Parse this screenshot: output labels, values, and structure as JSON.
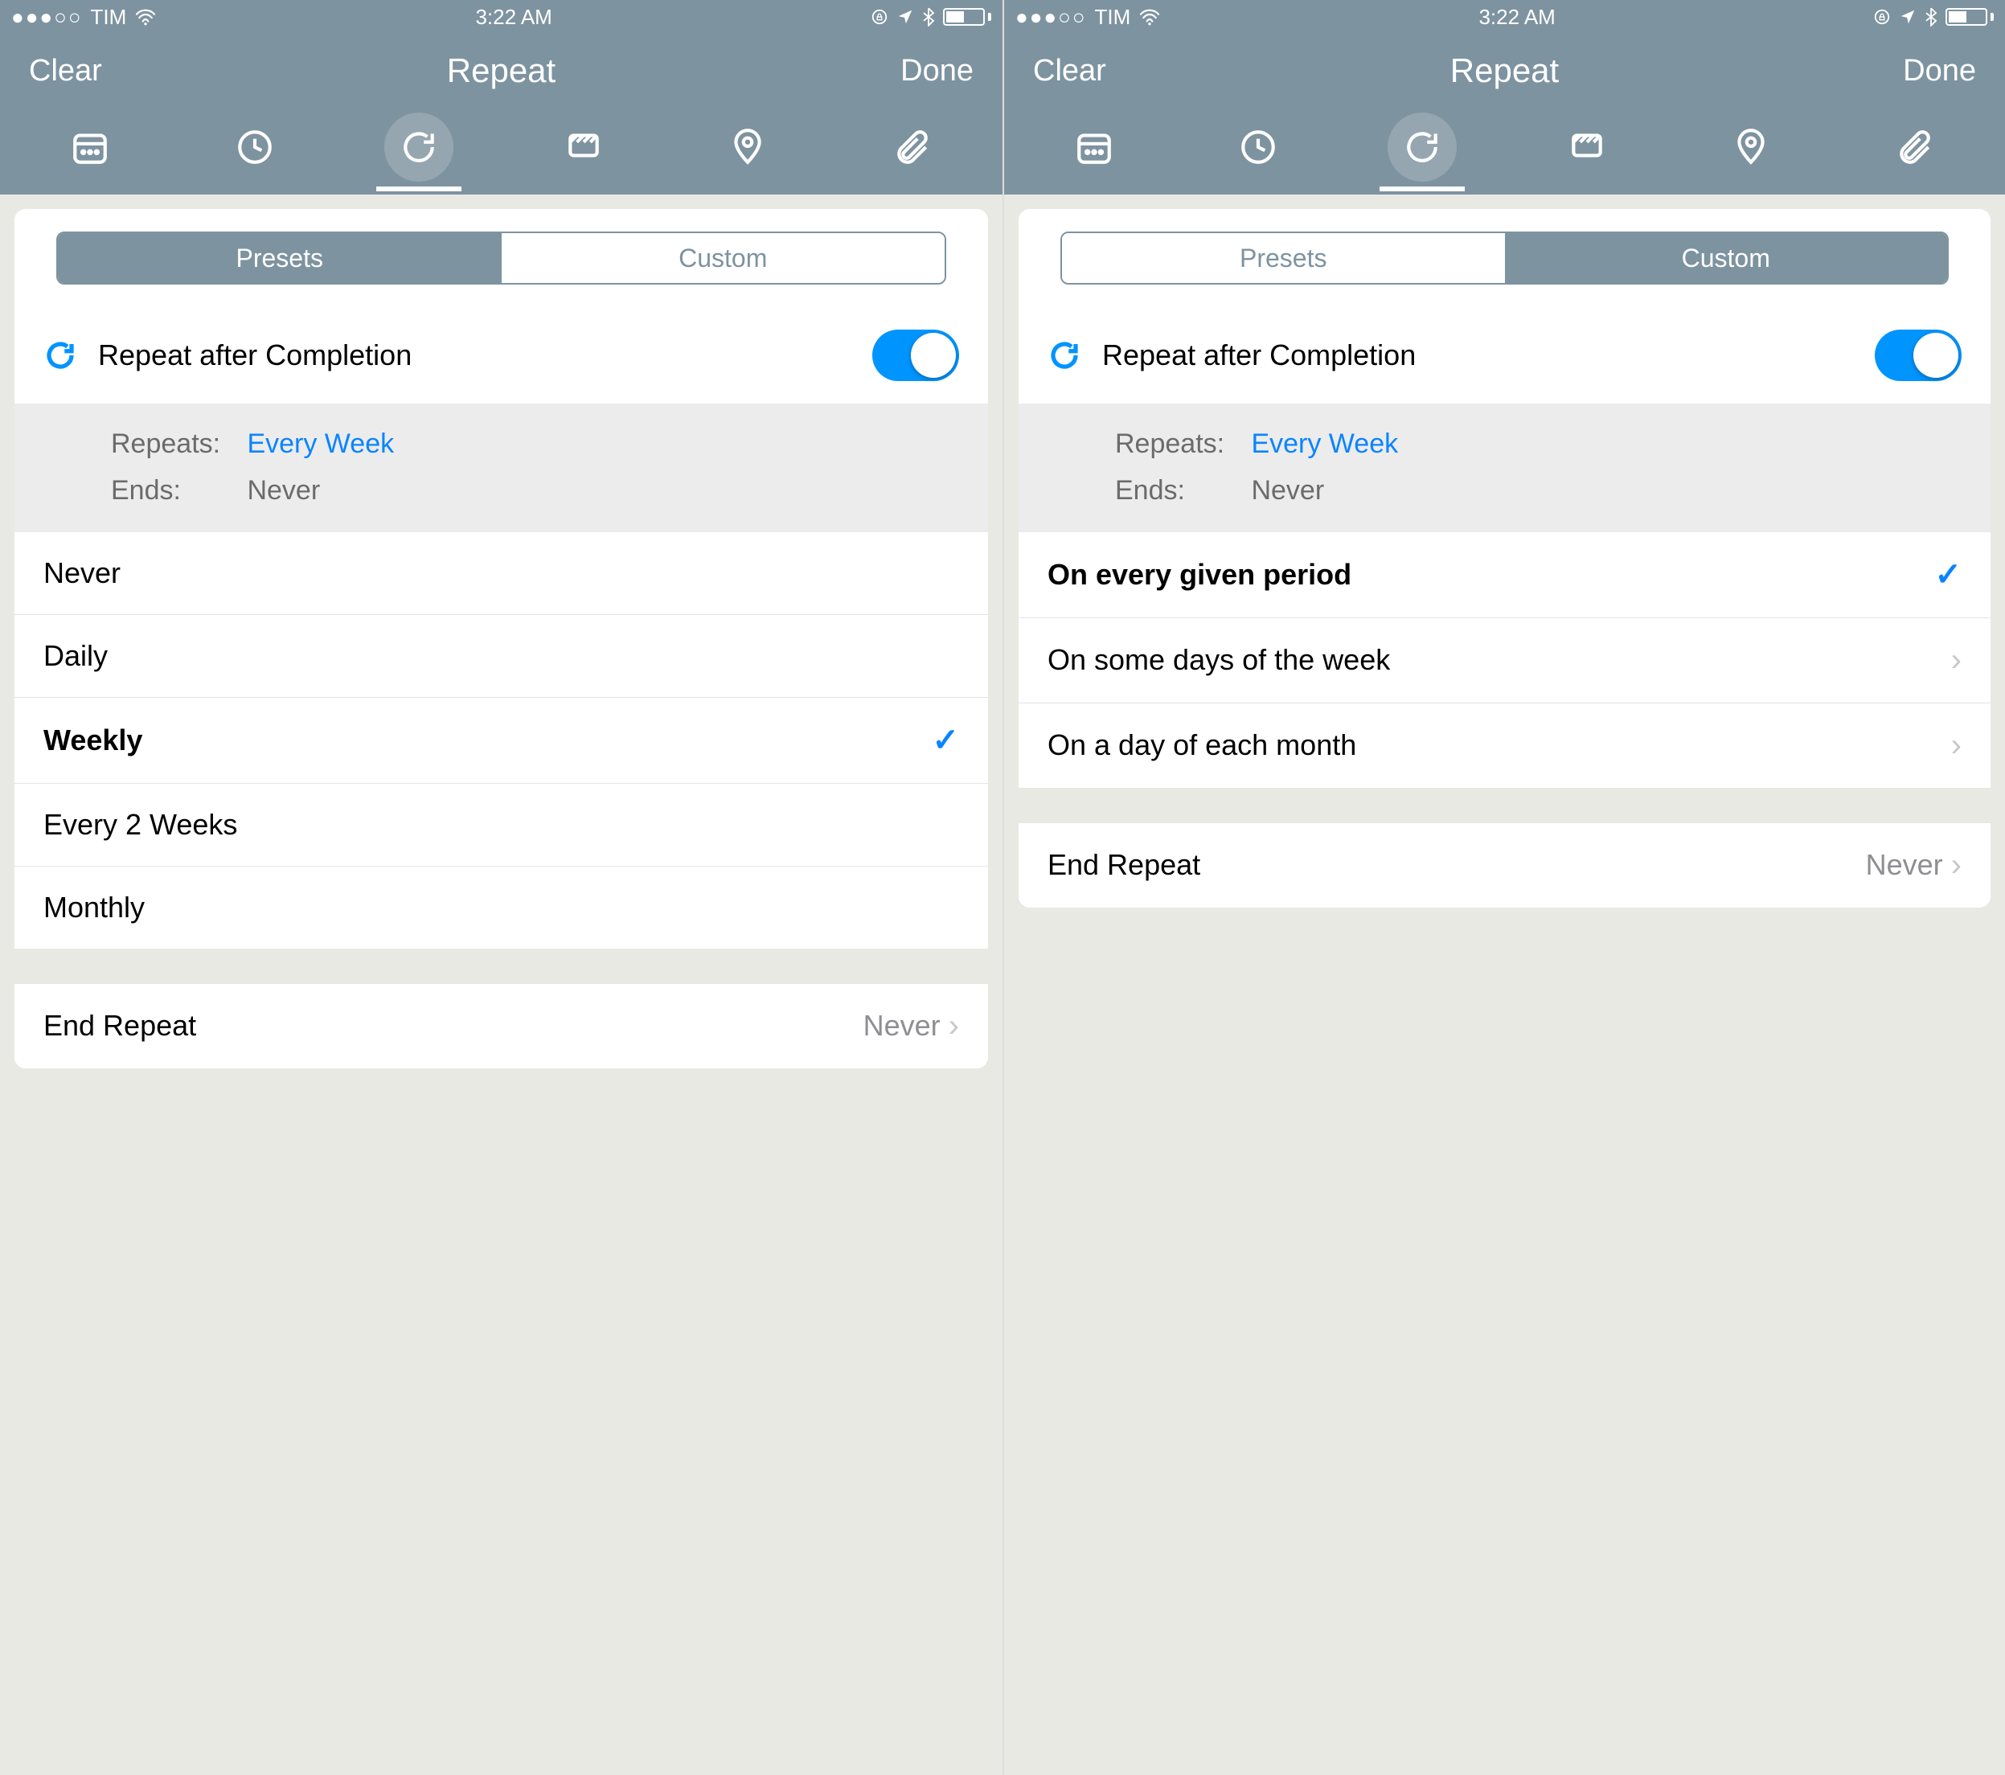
{
  "status": {
    "dots_filled": 3,
    "dots_total": 5,
    "carrier": "TIM",
    "time": "3:22 AM",
    "lock": true,
    "location": true,
    "bluetooth": true,
    "battery_pct": 45
  },
  "nav": {
    "left": "Clear",
    "title": "Repeat",
    "right": "Done"
  },
  "tabs": {
    "icons": [
      "calendar",
      "clock",
      "repeat",
      "flag",
      "location",
      "attachment"
    ],
    "active_index": 2
  },
  "segment": {
    "options": [
      "Presets",
      "Custom"
    ]
  },
  "repeat_row": {
    "label": "Repeat after Completion",
    "on": true
  },
  "summary": {
    "repeats_label": "Repeats:",
    "repeats_value": "Every Week",
    "ends_label": "Ends:",
    "ends_value": "Never"
  },
  "presets": {
    "options": [
      "Never",
      "Daily",
      "Weekly",
      "Every 2 Weeks",
      "Monthly"
    ],
    "selected_index": 2
  },
  "custom": {
    "options": [
      "On every given period",
      "On some days of the week",
      "On a day of each month"
    ],
    "selected_index": 0
  },
  "end_repeat": {
    "label": "End Repeat",
    "value": "Never"
  },
  "screens": [
    {
      "segment_selected": 0
    },
    {
      "segment_selected": 1
    }
  ]
}
